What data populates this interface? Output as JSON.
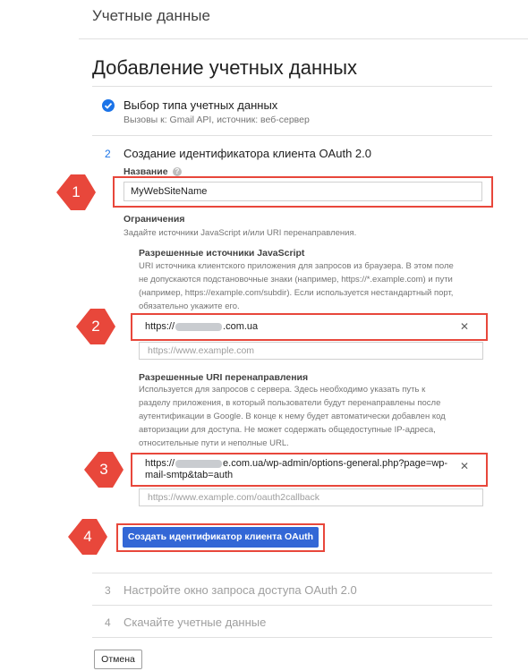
{
  "header": {
    "title": "Учетные данные"
  },
  "page": {
    "title": "Добавление учетных данных"
  },
  "step1": {
    "title": "Выбор типа учетных данных",
    "subtitle": "Вызовы к: Gmail API, источник: веб-сервер"
  },
  "step2": {
    "number": "2",
    "title": "Создание идентификатора клиента OAuth 2.0",
    "name_label": "Название",
    "name_value": "MyWebSiteName",
    "restrictions_title": "Ограничения",
    "restrictions_hint": "Задайте источники JavaScript и/или URI перенаправления.",
    "js_title": "Разрешенные источники JavaScript",
    "js_hint": [
      "URI источника клиентского приложения для запросов из браузера. В этом поле",
      "не допускаются подстановочные знаки (например, https://*.example.com) и пути",
      "(например, https://example.com/subdir). Если используется нестандартный порт,",
      "обязательно укажите его."
    ],
    "js_value_prefix": "https://",
    "js_value_suffix": ".com.ua",
    "js_placeholder": "https://www.example.com",
    "redirect_title": "Разрешенные URI перенаправления",
    "redirect_hint": [
      "Используется для запросов с сервера. Здесь необходимо указать путь к",
      "разделу приложения, в который пользователи будут перенаправлены после",
      "аутентификации в Google. В конце к нему будет автоматически добавлен код",
      "авторизации для доступа. Не может содержать общедоступные IP-адреса,",
      "относительные пути и неполные URL."
    ],
    "redirect_value_prefix": "https://",
    "redirect_value_line1_suffix": "e.com.ua/wp-admin/options-general.php?page=wp-",
    "redirect_value_line2": "mail-smtp&tab=auth",
    "redirect_placeholder": "https://www.example.com/oauth2callback",
    "create_button": "Создать идентификатор клиента OAuth"
  },
  "step3": {
    "number": "3",
    "title": "Настройте окно запроса доступа OAuth 2.0"
  },
  "step4": {
    "number": "4",
    "title": "Скачайте учетные данные"
  },
  "cancel_button": "Отмена",
  "callouts": [
    "1",
    "2",
    "3",
    "4"
  ],
  "colors": {
    "accent": "#1a73e8",
    "primary_button": "#3367d6",
    "callout": "#e8473b"
  }
}
